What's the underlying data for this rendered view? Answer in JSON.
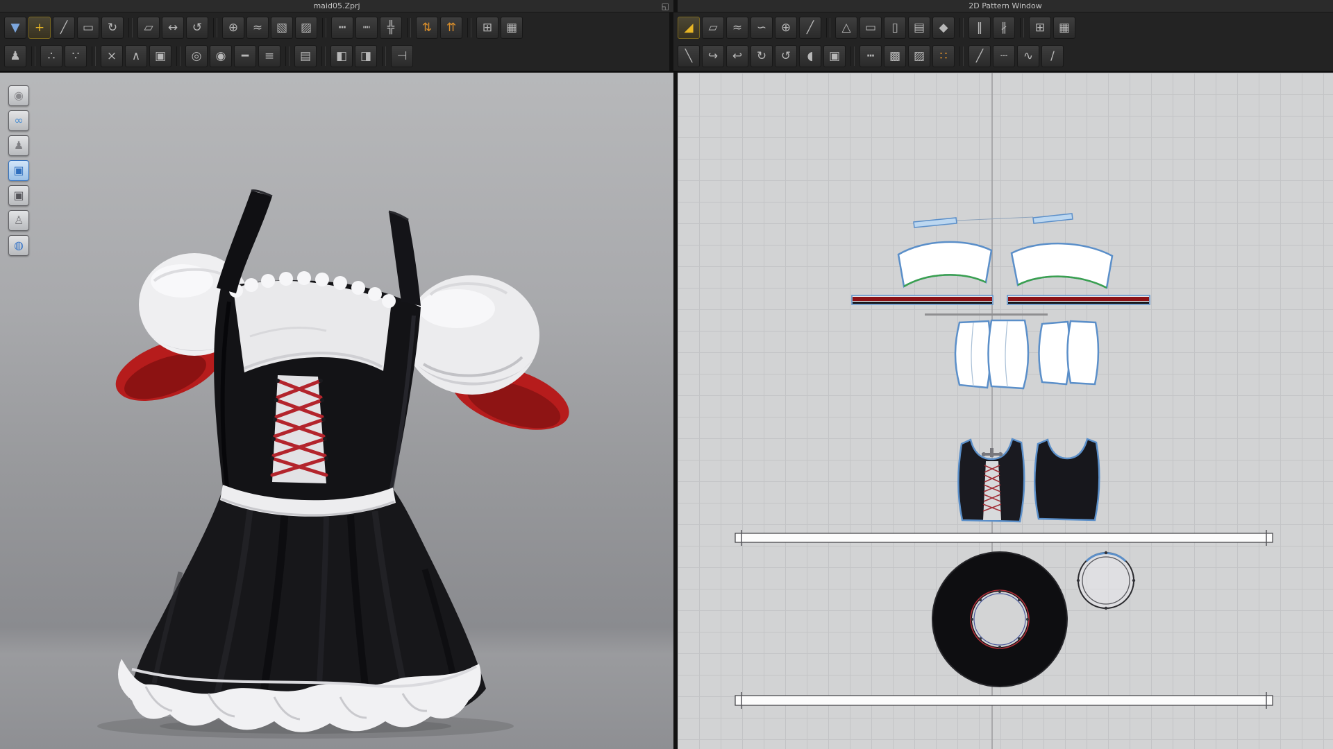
{
  "window": {
    "left_title": "maid05.Zprj",
    "right_title": "2D Pattern Window",
    "restore_glyph": "◱"
  },
  "colors": {
    "active_tool_accent": "#e8b625",
    "grading_accent": "#e8952a",
    "pattern_outline_blue": "#5b8fc9",
    "seam_green": "#3aa04e",
    "lace_red": "#b3242c",
    "trim_red": "#b61c1c"
  },
  "left_toolbar": {
    "row1": [
      {
        "name": "simulate",
        "glyph": "▼",
        "color": "#7ca6dd"
      },
      {
        "name": "select-move",
        "glyph": "+",
        "active": true,
        "color": "#e8b625"
      },
      {
        "name": "select-pen",
        "glyph": "╱"
      },
      {
        "name": "box-select",
        "glyph": "▭"
      },
      {
        "name": "transform-garment",
        "glyph": "↻"
      },
      {
        "type": "sep"
      },
      {
        "name": "edit-pattern",
        "glyph": "▱"
      },
      {
        "name": "move-pattern",
        "glyph": "↔"
      },
      {
        "name": "rotate-pattern",
        "glyph": "↺"
      },
      {
        "type": "sep"
      },
      {
        "name": "add-point",
        "glyph": "⊕"
      },
      {
        "name": "edit-curve",
        "glyph": "≈"
      },
      {
        "name": "edit-texture",
        "glyph": "▧"
      },
      {
        "name": "pattern-outline",
        "glyph": "▨"
      },
      {
        "type": "sep"
      },
      {
        "name": "segment-sewing",
        "glyph": "┅"
      },
      {
        "name": "free-sewing",
        "glyph": "┉"
      },
      {
        "name": "mn-sewing",
        "glyph": "╬"
      },
      {
        "type": "sep"
      },
      {
        "name": "fold-arrangement",
        "glyph": "⇅",
        "color": "#d98e2b"
      },
      {
        "name": "fold-strengthen",
        "glyph": "⇈",
        "color": "#d98e2b"
      },
      {
        "type": "sep"
      },
      {
        "name": "show-grid",
        "glyph": "⊞"
      },
      {
        "name": "pattern-table",
        "glyph": "▦"
      }
    ],
    "row2": [
      {
        "name": "avatar-display",
        "glyph": "♟"
      },
      {
        "type": "sep"
      },
      {
        "name": "arrangement-points",
        "glyph": "∴"
      },
      {
        "name": "arrangement-move",
        "glyph": "∵"
      },
      {
        "type": "sep"
      },
      {
        "name": "pose-reset",
        "glyph": "×"
      },
      {
        "name": "pose-edit",
        "glyph": "∧"
      },
      {
        "name": "show-garment-box",
        "glyph": "▣"
      },
      {
        "type": "sep"
      },
      {
        "name": "sewing-cursor",
        "glyph": "◎"
      },
      {
        "name": "button-tool",
        "glyph": "◉"
      },
      {
        "name": "buttonhole-tool",
        "glyph": "━"
      },
      {
        "name": "zipper-tool",
        "glyph": "≡"
      },
      {
        "type": "sep"
      },
      {
        "name": "tape-measure",
        "glyph": "▤"
      },
      {
        "type": "sep"
      },
      {
        "name": "flatten-left",
        "glyph": "◧"
      },
      {
        "name": "flatten-right",
        "glyph": "◨"
      },
      {
        "type": "sep"
      },
      {
        "name": "pin-tool",
        "glyph": "⊣"
      }
    ]
  },
  "right_toolbar": {
    "row1": [
      {
        "name": "transform-pattern",
        "glyph": "◢",
        "active": true,
        "color": "#e8b625"
      },
      {
        "name": "edit-pattern-2d",
        "glyph": "▱"
      },
      {
        "name": "edit-curvature",
        "glyph": "≈"
      },
      {
        "name": "edit-curve-point",
        "glyph": "∽"
      },
      {
        "name": "add-point-2d",
        "glyph": "⊕"
      },
      {
        "name": "add-segment",
        "glyph": "╱"
      },
      {
        "type": "sep"
      },
      {
        "name": "polygon-pattern",
        "glyph": "△"
      },
      {
        "name": "rectangle-pattern",
        "glyph": "▭"
      },
      {
        "name": "document-new",
        "glyph": "▯"
      },
      {
        "name": "folder-pattern",
        "glyph": "▤"
      },
      {
        "name": "shield-validate",
        "glyph": "◆"
      },
      {
        "type": "sep"
      },
      {
        "name": "pleats-fold",
        "glyph": "‖"
      },
      {
        "name": "pleats-sew",
        "glyph": "∦"
      },
      {
        "type": "sep"
      },
      {
        "name": "show-grid-2d",
        "glyph": "⊞"
      },
      {
        "name": "pattern-table-2d",
        "glyph": "▦"
      }
    ],
    "row2": [
      {
        "name": "edit-sewing",
        "glyph": "╲"
      },
      {
        "name": "move-sewing",
        "glyph": "↪"
      },
      {
        "name": "detach-sewing",
        "glyph": "↩"
      },
      {
        "name": "rotate-cw",
        "glyph": "↻"
      },
      {
        "name": "rotate-ccw",
        "glyph": "↺"
      },
      {
        "name": "steam-iron",
        "glyph": "◖"
      },
      {
        "name": "show-garment-2d",
        "glyph": "▣"
      },
      {
        "type": "sep"
      },
      {
        "name": "free-sewing-2d",
        "glyph": "┅"
      },
      {
        "name": "fabric-pattern-a",
        "glyph": "▩"
      },
      {
        "name": "fabric-pattern-b",
        "glyph": "▨"
      },
      {
        "name": "grading",
        "glyph": "∷",
        "color": "#e8952a"
      },
      {
        "type": "sep"
      },
      {
        "name": "line-tool",
        "glyph": "╱"
      },
      {
        "name": "dashed-line-tool",
        "glyph": "┄"
      },
      {
        "name": "curve-line-tool",
        "glyph": "∿"
      },
      {
        "name": "notch-tool",
        "glyph": "∕"
      }
    ]
  },
  "viewport_tools": [
    {
      "name": "render-view",
      "glyph": "◉",
      "color": "#8a8a8e"
    },
    {
      "name": "arrangement-spheres",
      "glyph": "∞",
      "color": "#4d8fd1"
    },
    {
      "name": "show-avatar",
      "glyph": "♟",
      "color": "#808084"
    },
    {
      "name": "show-garment",
      "glyph": "▣",
      "color": "#2f6fbe",
      "active": true
    },
    {
      "name": "show-mesh",
      "glyph": "▣",
      "color": "#55555a"
    },
    {
      "name": "avatar-silhouette",
      "glyph": "♙",
      "color": "#77777b"
    },
    {
      "name": "show-environment",
      "glyph": "◍",
      "color": "#3c78c8"
    }
  ]
}
